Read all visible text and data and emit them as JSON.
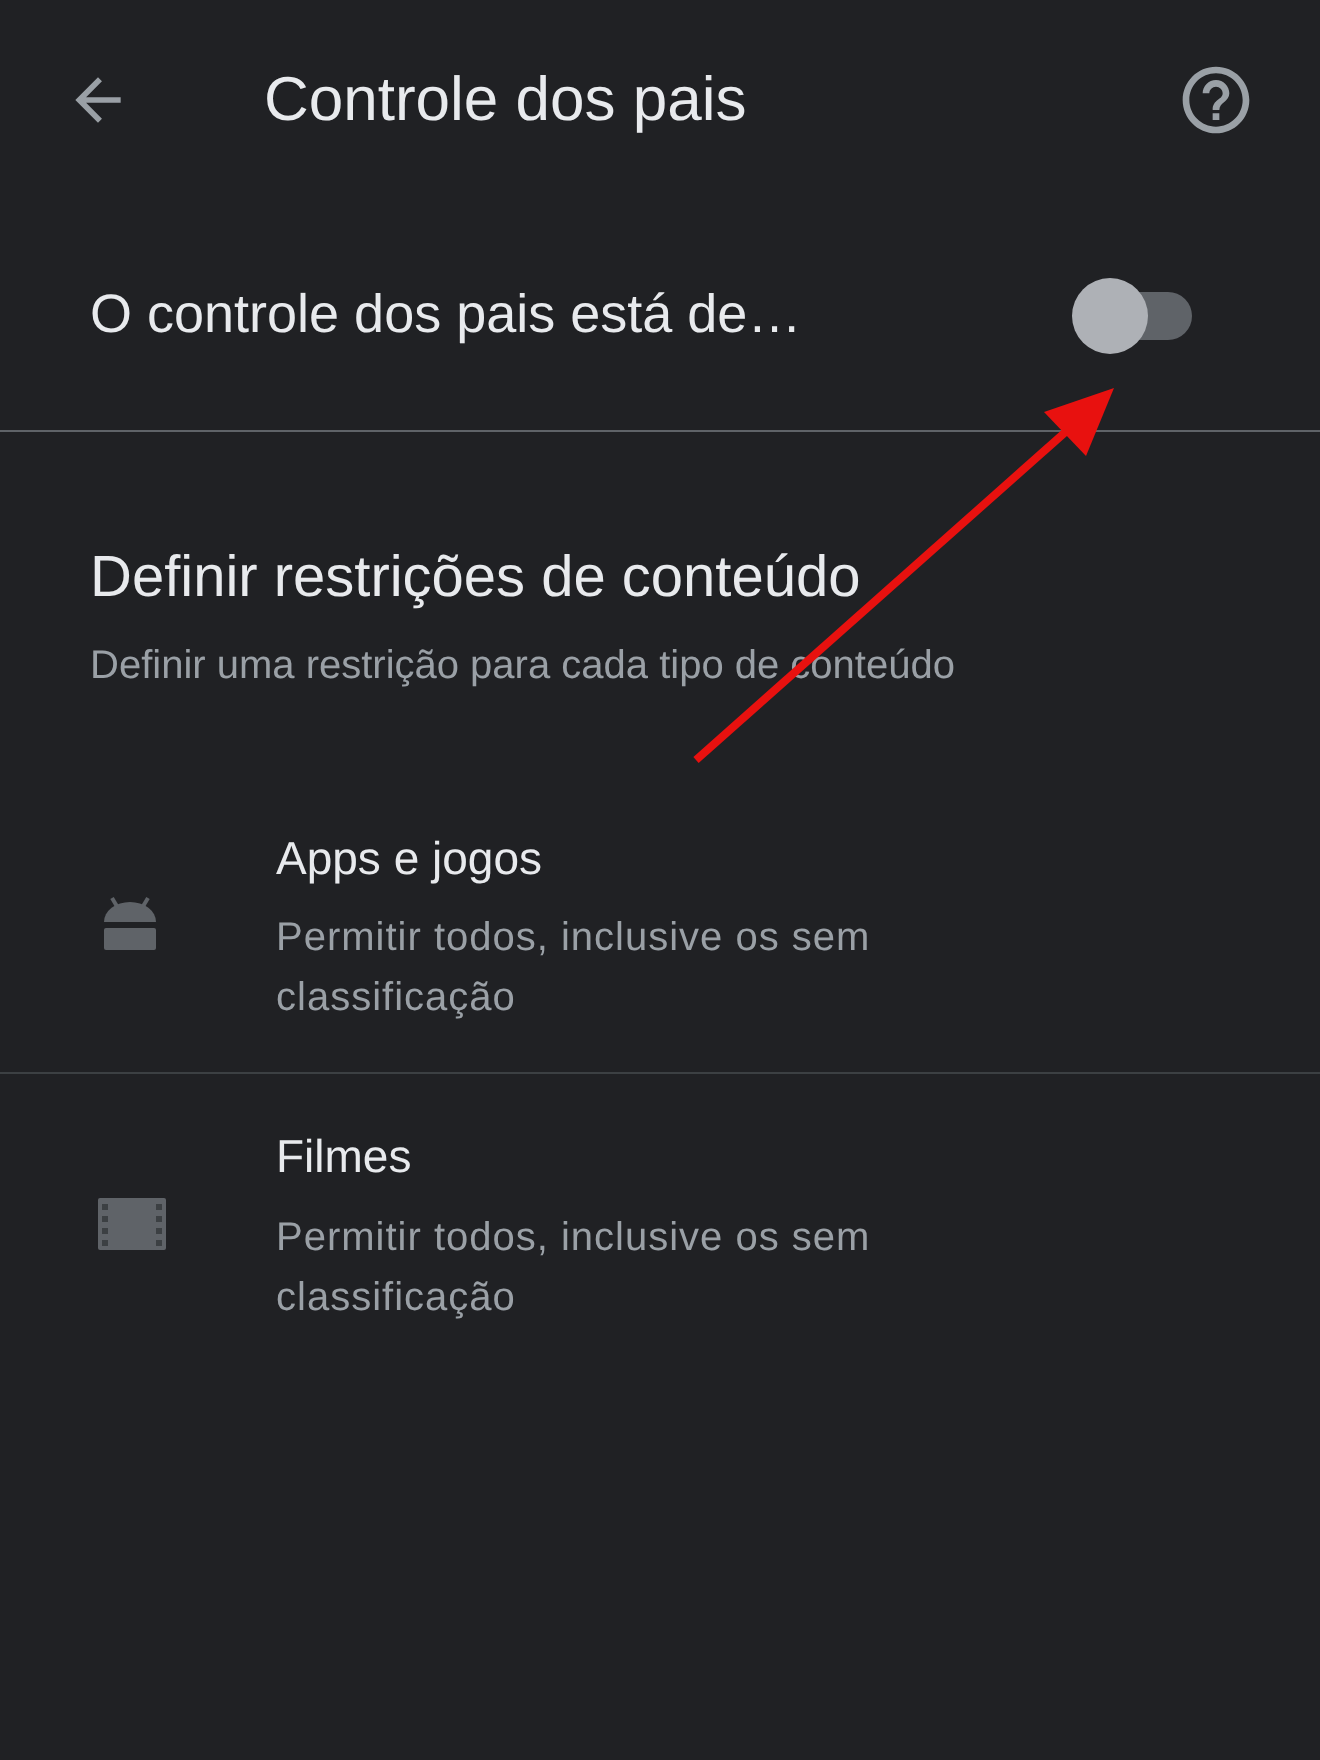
{
  "app_bar": {
    "title": "Controle dos pais"
  },
  "master_switch": {
    "label": "O controle dos pais está de…",
    "on": false
  },
  "section": {
    "title": "Definir restrições de conteúdo",
    "subtitle": "Definir uma restrição para cada tipo de conteúdo"
  },
  "items": [
    {
      "kind": "apps",
      "title": "Apps e jogos",
      "subtitle": "Permitir todos, inclusive os sem classificação"
    },
    {
      "kind": "movies",
      "title": "Filmes",
      "subtitle": "Permitir todos, inclusive os sem classificação"
    }
  ]
}
